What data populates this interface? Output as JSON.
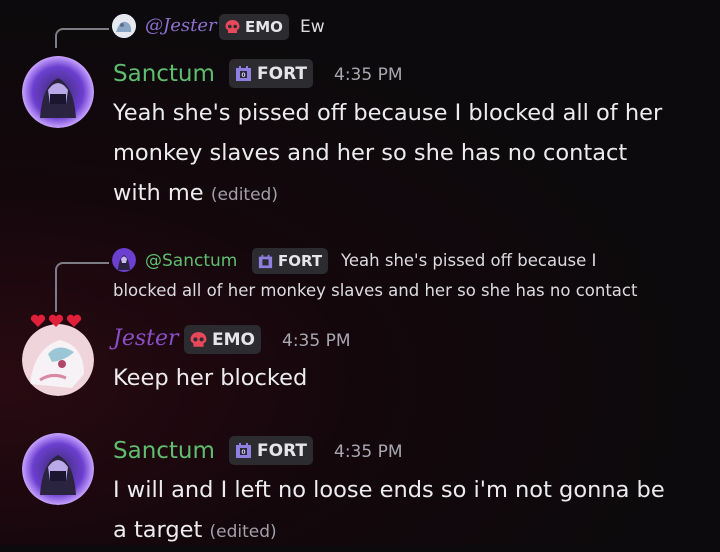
{
  "messages": [
    {
      "reply": {
        "author": "@Jester",
        "tag": "EMO",
        "text": "Ew"
      },
      "author": "Sanctum",
      "tag": "FORT",
      "time": "4:35 PM",
      "lines": [
        "Yeah she's pissed off because I blocked all of her",
        "monkey slaves and her so she has no contact",
        "with me"
      ],
      "edited": "(edited)"
    },
    {
      "reply": {
        "author": "@Sanctum",
        "tag": "FORT",
        "text_line1": "Yeah she's pissed off because I",
        "text_line2": "blocked all of her monkey slaves and her so she has no contact"
      },
      "author": "Jester",
      "tag": "EMO",
      "time": "4:35 PM",
      "lines": [
        "Keep her blocked"
      ]
    },
    {
      "author": "Sanctum",
      "tag": "FORT",
      "time": "4:35 PM",
      "lines": [
        "I will and I left no loose ends so i'm not gonna be",
        "a target"
      ],
      "edited": "(edited)"
    }
  ],
  "colors": {
    "sanctum_name": "#5fbe6e",
    "jester_name": "#8b4fc8",
    "emo_icon": "#e8485a",
    "fort_icon": "#8f7fe0"
  },
  "icons": {
    "emo": "skull-icon",
    "fort": "castle-icon",
    "hearts": "heart-icon"
  }
}
